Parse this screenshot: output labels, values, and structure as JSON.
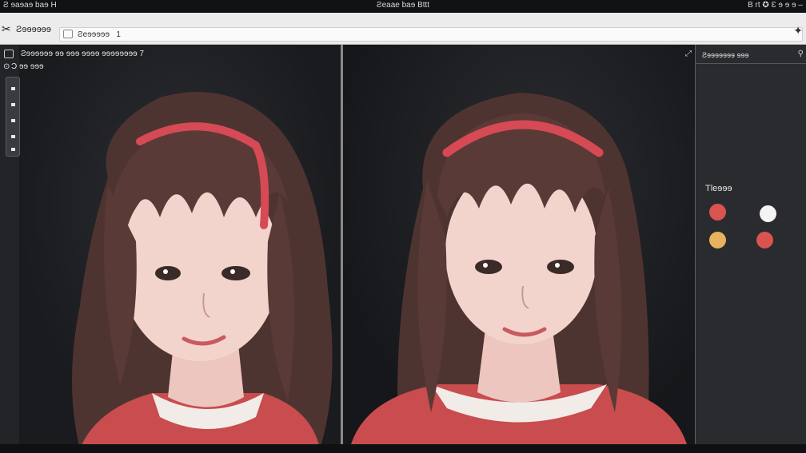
{
  "titlebar": {
    "left": "Ƨ ɘaɘaɘ baɘ H",
    "center": "Ƨeaae baɘ Bttt",
    "right": "B rt ✪ Ɛ ɘ ɘ ɘ –"
  },
  "toolbar": {
    "app_name": "Ƨɘɘɘɘɘɘ",
    "search_value": "Ƨeɘɘɘɘɘ   1",
    "scissors_icon": "scissors-icon",
    "sparkle_icon": "sparkle-icon"
  },
  "left_canvas": {
    "caption": "Ƨɘɘɘɘɘɘ ɘɘ ɘɘɘ ɘɘɘɘ ɘɘɘɘɘɘɘɘ 7",
    "sub": "Ɔ ɘɘ ɘɘɘ"
  },
  "panel": {
    "header": "Ƨɘɘɘɘɘɘɘ ɘɘɘ",
    "theme_label": "Tleɘɘɘ",
    "swatches": [
      {
        "name": "red",
        "color": "#d9544f"
      },
      {
        "name": "white",
        "color": "#f4f4f4"
      },
      {
        "name": "yellow",
        "color": "#e8b35e"
      },
      {
        "name": "coral",
        "color": "#d9544f"
      }
    ]
  },
  "colors": {
    "hair": "#5a3a36",
    "headband": "#d64a55",
    "skin": "#f2d3cc",
    "sweater": "#c94c4e"
  }
}
